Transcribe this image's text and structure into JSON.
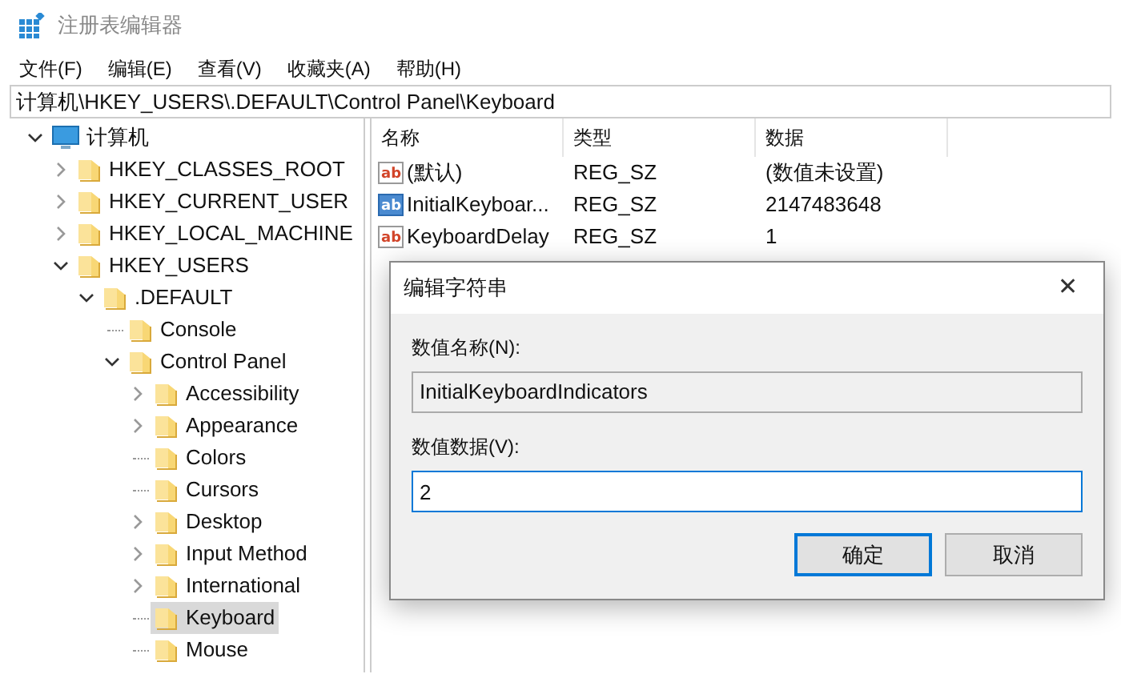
{
  "window": {
    "title": "注册表编辑器"
  },
  "menu": [
    "文件(F)",
    "编辑(E)",
    "查看(V)",
    "收藏夹(A)",
    "帮助(H)"
  ],
  "address": "计算机\\HKEY_USERS\\.DEFAULT\\Control Panel\\Keyboard",
  "tree": [
    {
      "label": "计算机",
      "kind": "computer",
      "expanded": true,
      "selected": false,
      "children": [
        {
          "label": "HKEY_CLASSES_ROOT",
          "kind": "branch",
          "expanded": false,
          "selected": false
        },
        {
          "label": "HKEY_CURRENT_USER",
          "kind": "branch",
          "expanded": false,
          "selected": false
        },
        {
          "label": "HKEY_LOCAL_MACHINE",
          "kind": "branch",
          "expanded": false,
          "selected": false
        },
        {
          "label": "HKEY_USERS",
          "kind": "branch",
          "expanded": true,
          "selected": false,
          "children": [
            {
              "label": ".DEFAULT",
              "kind": "branch",
              "expanded": true,
              "selected": false,
              "children": [
                {
                  "label": "Console",
                  "kind": "leaf",
                  "expanded": false,
                  "selected": false
                },
                {
                  "label": "Control Panel",
                  "kind": "branch",
                  "expanded": true,
                  "selected": false,
                  "children": [
                    {
                      "label": "Accessibility",
                      "kind": "branch",
                      "expanded": false,
                      "selected": false
                    },
                    {
                      "label": "Appearance",
                      "kind": "branch",
                      "expanded": false,
                      "selected": false
                    },
                    {
                      "label": "Colors",
                      "kind": "leaf",
                      "expanded": false,
                      "selected": false
                    },
                    {
                      "label": "Cursors",
                      "kind": "leaf",
                      "expanded": false,
                      "selected": false
                    },
                    {
                      "label": "Desktop",
                      "kind": "branch",
                      "expanded": false,
                      "selected": false
                    },
                    {
                      "label": "Input Method",
                      "kind": "branch",
                      "expanded": false,
                      "selected": false
                    },
                    {
                      "label": "International",
                      "kind": "branch",
                      "expanded": false,
                      "selected": false
                    },
                    {
                      "label": "Keyboard",
                      "kind": "leaf",
                      "expanded": false,
                      "selected": true
                    },
                    {
                      "label": "Mouse",
                      "kind": "leaf",
                      "expanded": false,
                      "selected": false
                    }
                  ]
                }
              ]
            }
          ]
        }
      ]
    }
  ],
  "table": {
    "columns": [
      "名称",
      "类型",
      "数据"
    ],
    "rows": [
      {
        "icon": "ab",
        "name": "(默认)",
        "type": "REG_SZ",
        "data": "(数值未设置)",
        "selected": false
      },
      {
        "icon": "ab",
        "name": "InitialKeyboar...",
        "type": "REG_SZ",
        "data": "2147483648",
        "selected": true
      },
      {
        "icon": "ab",
        "name": "KeyboardDelay",
        "type": "REG_SZ",
        "data": "1",
        "selected": false
      }
    ]
  },
  "dialog": {
    "title": "编辑字符串",
    "close": "✕",
    "name_label": "数值名称(N):",
    "name_value": "InitialKeyboardIndicators",
    "data_label": "数值数据(V):",
    "data_value": "2",
    "buttons": [
      {
        "label": "确定",
        "default": true
      },
      {
        "label": "取消",
        "default": false
      }
    ]
  }
}
